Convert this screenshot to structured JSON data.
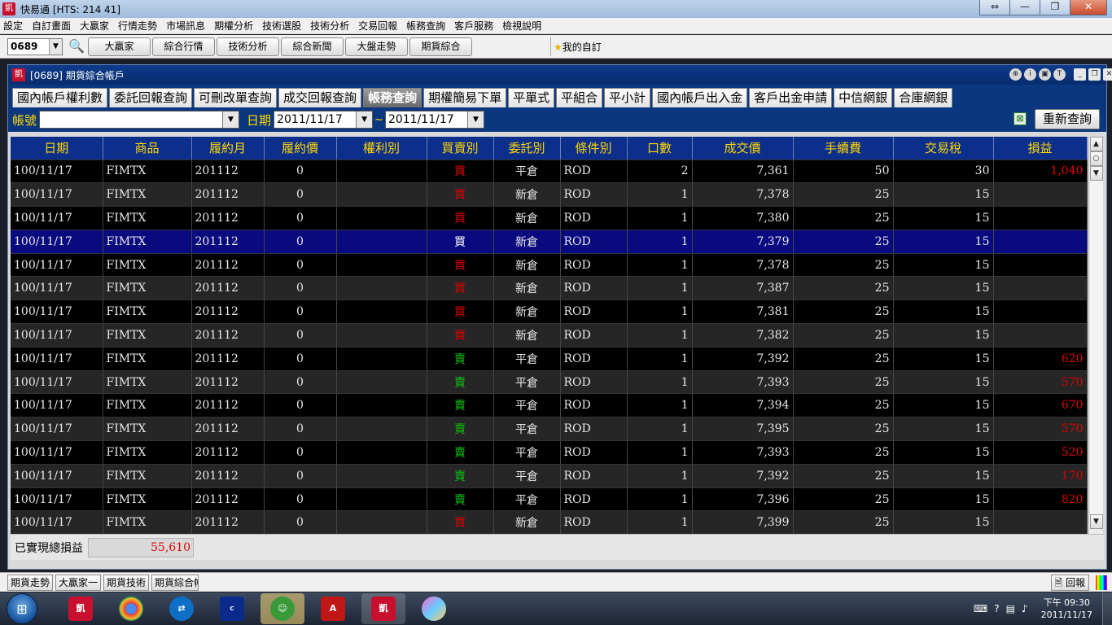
{
  "app": {
    "title": "快易通 [HTS: 214 41]",
    "logo": "凱"
  },
  "window_buttons": [
    "⇔",
    "—",
    "❐",
    "✕"
  ],
  "menu": [
    "設定",
    "自訂畫面",
    "大贏家",
    "行情走勢",
    "市場訊息",
    "期權分析",
    "技術選股",
    "技術分析",
    "交易回報",
    "帳務查詢",
    "客戶服務",
    "檢視說明"
  ],
  "toolbar": {
    "code": "0689",
    "buttons": [
      "大贏家",
      "綜合行情",
      "技術分析",
      "綜合新聞",
      "大盤走勢",
      "期貨綜合"
    ],
    "favorite": "我的自訂"
  },
  "inner_window": {
    "title": "[0689] 期貨綜合帳戶",
    "logo": "凱"
  },
  "tabs": [
    "國內帳戶權利數",
    "委託回報查詢",
    "可刪改單查詢",
    "成交回報查詢",
    "帳務查詢",
    "期權簡易下單",
    "平單式",
    "平組合",
    "平小計",
    "國內帳戶出入金",
    "客戶出金申請",
    "中信網銀",
    "合庫網銀"
  ],
  "active_tab": "帳務查詢",
  "filter": {
    "account_label": "帳號",
    "account_value": "",
    "date_label": "日期",
    "date_from": "2011/11/17",
    "tilde": "~",
    "date_to": "2011/11/17",
    "requery_label": "重新查詢"
  },
  "table": {
    "columns": [
      "日期",
      "商品",
      "履約月",
      "履約價",
      "權利別",
      "買賣別",
      "委託別",
      "條件別",
      "口數",
      "成交價",
      "手續費",
      "交易稅",
      "損益"
    ],
    "selected_row": 3,
    "rows": [
      [
        "100/11/17",
        "FIMTX",
        "201112",
        "0",
        "",
        "買",
        "平倉",
        "ROD",
        "2",
        "7,361",
        "50",
        "30",
        "1,040"
      ],
      [
        "100/11/17",
        "FIMTX",
        "201112",
        "0",
        "",
        "買",
        "新倉",
        "ROD",
        "1",
        "7,378",
        "25",
        "15",
        ""
      ],
      [
        "100/11/17",
        "FIMTX",
        "201112",
        "0",
        "",
        "買",
        "新倉",
        "ROD",
        "1",
        "7,380",
        "25",
        "15",
        ""
      ],
      [
        "100/11/17",
        "FIMTX",
        "201112",
        "0",
        "",
        "買",
        "新倉",
        "ROD",
        "1",
        "7,379",
        "25",
        "15",
        ""
      ],
      [
        "100/11/17",
        "FIMTX",
        "201112",
        "0",
        "",
        "買",
        "新倉",
        "ROD",
        "1",
        "7,378",
        "25",
        "15",
        ""
      ],
      [
        "100/11/17",
        "FIMTX",
        "201112",
        "0",
        "",
        "買",
        "新倉",
        "ROD",
        "1",
        "7,387",
        "25",
        "15",
        ""
      ],
      [
        "100/11/17",
        "FIMTX",
        "201112",
        "0",
        "",
        "買",
        "新倉",
        "ROD",
        "1",
        "7,381",
        "25",
        "15",
        ""
      ],
      [
        "100/11/17",
        "FIMTX",
        "201112",
        "0",
        "",
        "買",
        "新倉",
        "ROD",
        "1",
        "7,382",
        "25",
        "15",
        ""
      ],
      [
        "100/11/17",
        "FIMTX",
        "201112",
        "0",
        "",
        "賣",
        "平倉",
        "ROD",
        "1",
        "7,392",
        "25",
        "15",
        "620"
      ],
      [
        "100/11/17",
        "FIMTX",
        "201112",
        "0",
        "",
        "賣",
        "平倉",
        "ROD",
        "1",
        "7,393",
        "25",
        "15",
        "570"
      ],
      [
        "100/11/17",
        "FIMTX",
        "201112",
        "0",
        "",
        "賣",
        "平倉",
        "ROD",
        "1",
        "7,394",
        "25",
        "15",
        "670"
      ],
      [
        "100/11/17",
        "FIMTX",
        "201112",
        "0",
        "",
        "賣",
        "平倉",
        "ROD",
        "1",
        "7,395",
        "25",
        "15",
        "570"
      ],
      [
        "100/11/17",
        "FIMTX",
        "201112",
        "0",
        "",
        "賣",
        "平倉",
        "ROD",
        "1",
        "7,393",
        "25",
        "15",
        "520"
      ],
      [
        "100/11/17",
        "FIMTX",
        "201112",
        "0",
        "",
        "賣",
        "平倉",
        "ROD",
        "1",
        "7,392",
        "25",
        "15",
        "170"
      ],
      [
        "100/11/17",
        "FIMTX",
        "201112",
        "0",
        "",
        "賣",
        "平倉",
        "ROD",
        "1",
        "7,396",
        "25",
        "15",
        "820"
      ],
      [
        "100/11/17",
        "FIMTX",
        "201112",
        "0",
        "",
        "買",
        "新倉",
        "ROD",
        "1",
        "7,399",
        "25",
        "15",
        ""
      ]
    ]
  },
  "footer": {
    "label": "已實現總損益",
    "value": "55,610"
  },
  "bottom_strip": {
    "buttons": [
      "期貨走勢",
      "大贏家一",
      "期貨技術",
      "期貨綜合帳戶"
    ],
    "report": "回報"
  },
  "taskbar": {
    "icons": [
      "kgi-icon",
      "chrome-icon",
      "teamviewer-icon",
      "concord-icon",
      "messenger-icon",
      "acrobat-icon",
      "kgi-icon",
      "paint-icon"
    ],
    "time": "下午 09:30",
    "date": "2011/11/17"
  },
  "colors": {
    "buy": "#e00000",
    "sell": "#12c012",
    "header_bg": "#0d2f8c",
    "header_text": "#ffd700",
    "selected_row": "#0a0a80"
  }
}
